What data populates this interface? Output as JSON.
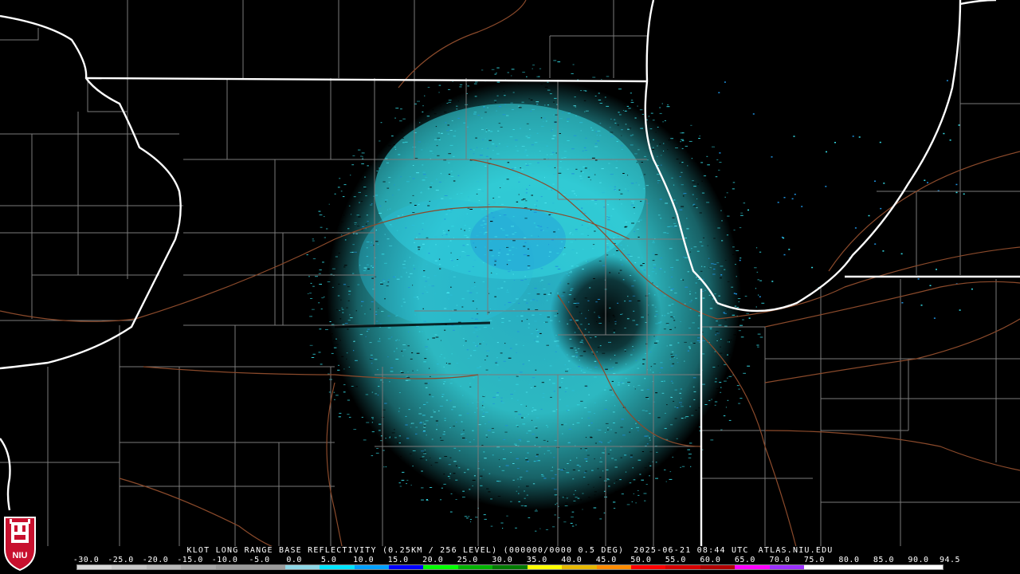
{
  "title": {
    "product": "KLOT LONG RANGE BASE REFLECTIVITY (0.25KM / 256 LEVEL) (000000/0000 0.5 DEG)",
    "timestamp": "2025-06-21 08:44 UTC",
    "source": "ATLAS.NIU.EDU"
  },
  "logo": {
    "text": "NIU",
    "colors": {
      "red": "#c8102e",
      "white": "#ffffff"
    }
  },
  "scale": {
    "labels": [
      "-30.0",
      "-25.0",
      "-20.0",
      "-15.0",
      "-10.0",
      "-5.0",
      "0.0",
      "5.0",
      "10.0",
      "15.0",
      "20.0",
      "25.0",
      "30.0",
      "35.0",
      "40.0",
      "45.0",
      "50.0",
      "55.0",
      "60.0",
      "65.0",
      "70.0",
      "75.0",
      "80.0",
      "85.0",
      "90.0",
      "94.5"
    ],
    "colors": [
      "#d9d9d9",
      "#c9c9c9",
      "#b9b9b9",
      "#a9a9a9",
      "#999999",
      "#9b9b9b",
      "#8dd7e6",
      "#00e5ff",
      "#00a0ff",
      "#0000ff",
      "#00ff00",
      "#00b300",
      "#007a00",
      "#ffff00",
      "#e6b800",
      "#ff8c00",
      "#ff0000",
      "#d60000",
      "#b00000",
      "#ff00ff",
      "#9b30ff",
      "#ffffff",
      "#ffffff",
      "#ffffff",
      "#ffffff"
    ]
  },
  "map_colors": {
    "state_lines": "#ffffff",
    "county_lines": "#7a7a7a",
    "highways": "#8b4a2b",
    "echo_light": "#35d9e3",
    "echo_mid": "#2bbfd6",
    "echo_dense": "#1e8fdc"
  }
}
